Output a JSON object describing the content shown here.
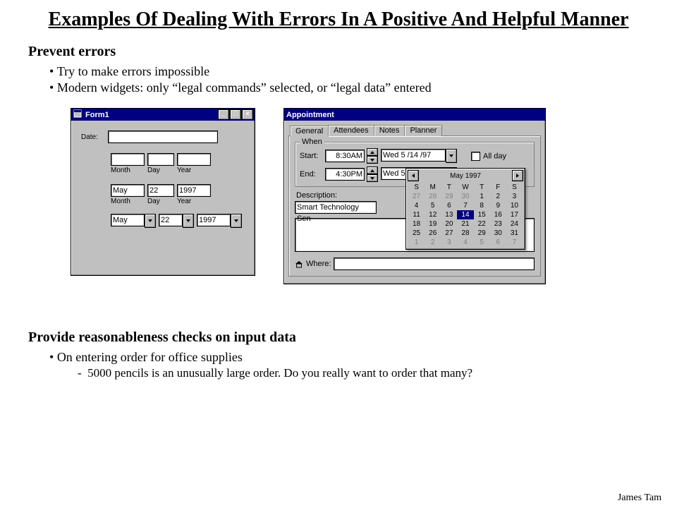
{
  "title": "Examples Of Dealing With Errors In A Positive And Helpful Manner",
  "section1": {
    "heading": "Prevent errors",
    "b1": "Try to make errors impossible",
    "b2": "Modern widgets:  only “legal commands” selected, or “legal data” entered"
  },
  "section2": {
    "heading": "Provide reasonableness checks on input data",
    "b1": "On entering order for office supplies",
    "s1": "5000 pencils is an unusually large order. Do you really want to order that many?"
  },
  "footer": "James Tam",
  "form1": {
    "title": "Form1",
    "date_label": "Date:",
    "labels": {
      "month": "Month",
      "day": "Day",
      "year": "Year"
    },
    "row2": {
      "month": "May",
      "day": "22",
      "year": "1997"
    },
    "row3": {
      "month": "May",
      "day": "22",
      "year": "1997"
    }
  },
  "appt": {
    "title": "Appointment",
    "tabs": [
      "General",
      "Attendees",
      "Notes",
      "Planner"
    ],
    "when_legend": "When",
    "start_label": "Start:",
    "end_label": "End:",
    "start_time": "8:30AM",
    "end_time": "4:30PM",
    "start_date": "Wed 5 /14 /97",
    "end_date": "Wed 5 /14 /97",
    "allday": "All day",
    "desc_label": "Description:",
    "desc_value": "Smart Technology Sen",
    "where_label": "Where:",
    "calendar": {
      "month_label": "May 1997",
      "dow": [
        "S",
        "M",
        "T",
        "W",
        "T",
        "F",
        "S"
      ],
      "leading": [
        "27",
        "28",
        "29",
        "30"
      ],
      "days": [
        "1",
        "2",
        "3",
        "4",
        "5",
        "6",
        "7",
        "8",
        "9",
        "10",
        "11",
        "12",
        "13",
        "14",
        "15",
        "16",
        "17",
        "18",
        "19",
        "20",
        "21",
        "22",
        "23",
        "24",
        "25",
        "26",
        "27",
        "28",
        "29",
        "30",
        "31"
      ],
      "trailing": [
        "1",
        "2",
        "3",
        "4",
        "5",
        "6",
        "7"
      ],
      "selected": "14"
    }
  }
}
